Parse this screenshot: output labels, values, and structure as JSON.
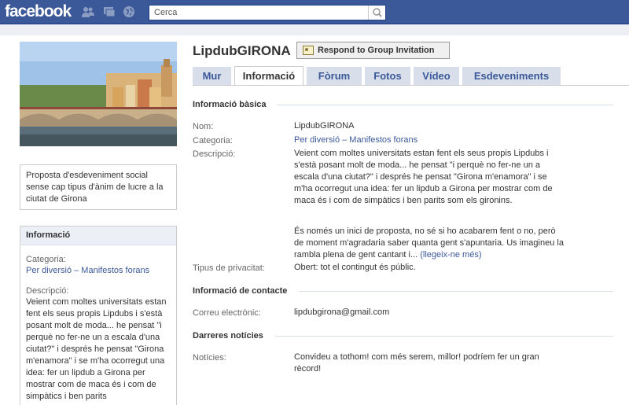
{
  "topbar": {
    "logo": "facebook",
    "search_placeholder": "Cerca",
    "icons": [
      "friends-icon",
      "messages-icon",
      "notifications-globe-icon",
      "search-icon"
    ]
  },
  "group": {
    "name": "LipdubGIRONA",
    "respond_label": "Respond to Group Invitation"
  },
  "tabs": [
    {
      "label": "Mur",
      "active": false
    },
    {
      "label": "Informació",
      "active": true
    },
    {
      "label": "Fòrum",
      "active": false
    },
    {
      "label": "Fotos",
      "active": false
    },
    {
      "label": "Vídeo",
      "active": false
    },
    {
      "label": "Esdeveniments",
      "active": false
    }
  ],
  "sidebar": {
    "description": "Proposta d'esdeveniment social sense cap tipus d'ànim de lucre a la ciutat de Girona",
    "info_header": "Informació",
    "category_label": "Categoria:",
    "category_value": "Per diversió – Manifestos forans",
    "desc_label": "Descripció:",
    "desc_value": "Veient com moltes universitats estan fent els seus propis Lipdubs i s'està posant molt de moda... he pensat \"i perquè no fer-ne un a escala d'una ciutat?\" i després he pensat \"Girona m'enamora\" i se m'ha ocorregut una idea: fer un lipdub a Girona per mostrar com de maca és i com de simpàtics i ben parits"
  },
  "info": {
    "basic_header": "Informació bàsica",
    "name_label": "Nom:",
    "name_value": "LipdubGIRONA",
    "category_label": "Categoria:",
    "category_value": "Per diversió – Manifestos forans",
    "desc_label": "Descripció:",
    "desc_p1": "Veient com moltes universitats estan fent els seus propis Lipdubs i s'està posant molt de moda... he pensat \"i perquè no fer-ne un a escala d'una ciutat?\" i després he pensat \"Girona m'enamora\" i se m'ha ocorregut una idea: fer un lipdub a Girona per mostrar com de maca és i com de simpàtics i ben parits som els gironins.",
    "desc_p2": "És només un inici de proposta, no sé si ho acabarem fent o no, però de moment m'agradaria saber quanta gent s'apuntaria. Us imagineu la rambla plena de gent cantant i...",
    "read_more": "(llegeix-ne més)",
    "privacy_label": "Tipus de privacitat:",
    "privacy_value": "Obert: tot el contingut és públic.",
    "contact_header": "Informació de contacte",
    "email_label": "Correu electrònic:",
    "email_value": "lipdubgirona@gmail.com",
    "news_header": "Darreres notícies",
    "news_label": "Notícies:",
    "news_value": "Convideu a tothom! com més serem, millor! podríem fer un gran rècord!"
  },
  "colors": {
    "brand": "#3b5998",
    "tab_bg": "#d8dfea",
    "strip": "#edeff4"
  }
}
